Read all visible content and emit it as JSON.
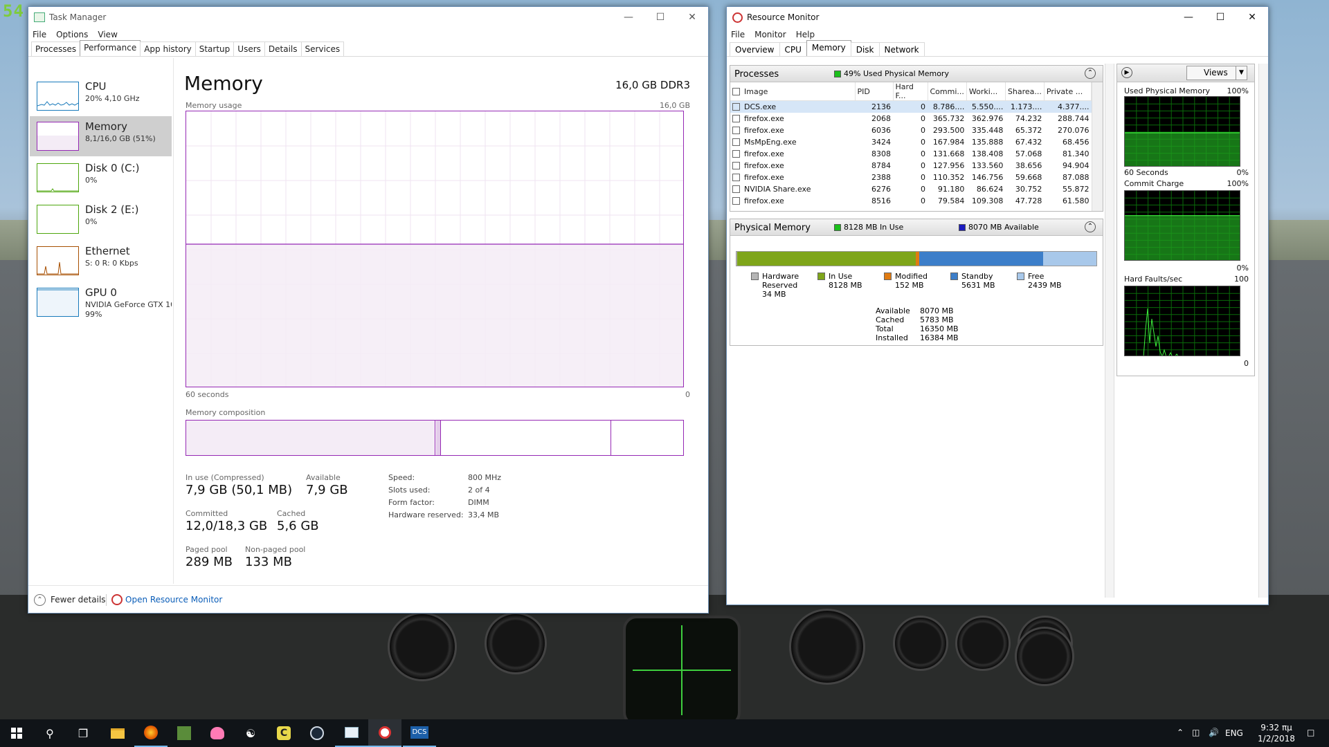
{
  "desktop": {
    "logo_text": "54"
  },
  "task_manager": {
    "title": "Task Manager",
    "menu": [
      "File",
      "Options",
      "View"
    ],
    "tabs": [
      "Processes",
      "Performance",
      "App history",
      "Startup",
      "Users",
      "Details",
      "Services"
    ],
    "active_tab": "Performance",
    "sidebar": [
      {
        "name": "CPU",
        "sub": "20%  4,10 GHz",
        "sub2": "",
        "color": "#1779ba"
      },
      {
        "name": "Memory",
        "sub": "8,1/16,0 GB (51%)",
        "sub2": "",
        "color": "#9528b4"
      },
      {
        "name": "Disk 0 (C:)",
        "sub": "0%",
        "sub2": "",
        "color": "#4da60c"
      },
      {
        "name": "Disk 2 (E:)",
        "sub": "0%",
        "sub2": "",
        "color": "#4da60c"
      },
      {
        "name": "Ethernet",
        "sub": "S: 0  R: 0 Kbps",
        "sub2": "",
        "color": "#a74f01"
      },
      {
        "name": "GPU 0",
        "sub": "NVIDIA GeForce GTX 10",
        "sub2": "99%",
        "color": "#1779ba"
      }
    ],
    "memory": {
      "title": "Memory",
      "capacity": "16,0 GB DDR3",
      "usage_label": "Memory usage",
      "usage_max": "16,0 GB",
      "time_label": "60 seconds",
      "time_end": "0",
      "usage_fraction": 0.51,
      "composition_label": "Memory composition",
      "stats": {
        "in_use_label": "In use (Compressed)",
        "in_use_value": "7,9 GB (50,1 MB)",
        "available_label": "Available",
        "available_value": "7,9 GB",
        "committed_label": "Committed",
        "committed_value": "12,0/18,3 GB",
        "cached_label": "Cached",
        "cached_value": "5,6 GB",
        "paged_label": "Paged pool",
        "paged_value": "289 MB",
        "nonpaged_label": "Non-paged pool",
        "nonpaged_value": "133 MB"
      },
      "details": [
        {
          "k": "Speed:",
          "v": "800 MHz"
        },
        {
          "k": "Slots used:",
          "v": "2 of 4"
        },
        {
          "k": "Form factor:",
          "v": "DIMM"
        },
        {
          "k": "Hardware reserved:",
          "v": "33,4 MB"
        }
      ]
    },
    "footer": {
      "fewer": "Fewer details",
      "open_rm": "Open Resource Monitor"
    }
  },
  "resource_monitor": {
    "title": "Resource Monitor",
    "menu": [
      "File",
      "Monitor",
      "Help"
    ],
    "tabs": [
      "Overview",
      "CPU",
      "Memory",
      "Disk",
      "Network"
    ],
    "active_tab": "Memory",
    "processes": {
      "title": "Processes",
      "tag": "49% Used Physical Memory",
      "columns": [
        "Image",
        "PID",
        "Hard F...",
        "Commi...",
        "Worki...",
        "Sharea...",
        "Private ..."
      ],
      "rows": [
        [
          "DCS.exe",
          "2136",
          "0",
          "8.786....",
          "5.550....",
          "1.173....",
          "4.377...."
        ],
        [
          "firefox.exe",
          "2068",
          "0",
          "365.732",
          "362.976",
          "74.232",
          "288.744"
        ],
        [
          "firefox.exe",
          "6036",
          "0",
          "293.500",
          "335.448",
          "65.372",
          "270.076"
        ],
        [
          "MsMpEng.exe",
          "3424",
          "0",
          "167.984",
          "135.888",
          "67.432",
          "68.456"
        ],
        [
          "firefox.exe",
          "8308",
          "0",
          "131.668",
          "138.408",
          "57.068",
          "81.340"
        ],
        [
          "firefox.exe",
          "8784",
          "0",
          "127.956",
          "133.560",
          "38.656",
          "94.904"
        ],
        [
          "firefox.exe",
          "2388",
          "0",
          "110.352",
          "146.756",
          "59.668",
          "87.088"
        ],
        [
          "NVIDIA Share.exe",
          "6276",
          "0",
          "91.180",
          "86.624",
          "30.752",
          "55.872"
        ],
        [
          "firefox.exe",
          "8516",
          "0",
          "79.584",
          "109.308",
          "47.728",
          "61.580"
        ]
      ]
    },
    "physical": {
      "title": "Physical Memory",
      "in_use_tag": "8128 MB In Use",
      "available_tag": "8070 MB Available",
      "bar_mb": {
        "hardware_reserved": 34,
        "in_use": 8128,
        "modified": 152,
        "standby": 5631,
        "free": 2439
      },
      "legend": [
        {
          "name": "Hardware Reserved",
          "value": "34 MB",
          "color": "#b5b5b5"
        },
        {
          "name": "In Use",
          "value": "8128 MB",
          "color": "#7ea51a"
        },
        {
          "name": "Modified",
          "value": "152 MB",
          "color": "#e07b12"
        },
        {
          "name": "Standby",
          "value": "5631 MB",
          "color": "#3c7ec9"
        },
        {
          "name": "Free",
          "value": "2439 MB",
          "color": "#a8c8ea"
        }
      ],
      "summary": [
        {
          "k": "Available",
          "v": "8070 MB"
        },
        {
          "k": "Cached",
          "v": "5783 MB"
        },
        {
          "k": "Total",
          "v": "16350 MB"
        },
        {
          "k": "Installed",
          "v": "16384 MB"
        }
      ]
    },
    "right": {
      "views_label": "Views",
      "g1_title": "Used Physical Memory",
      "g1_max": "100%",
      "g1_time": "60 Seconds",
      "g1_min": "0%",
      "g2_title": "Commit Charge",
      "g2_max": "100%",
      "g2_min": "0%",
      "g3_title": "Hard Faults/sec",
      "g3_max": "100",
      "g3_min": "0"
    }
  },
  "taskbar": {
    "lang": "ENG",
    "time": "9:32 πμ",
    "date": "1/2/2018"
  }
}
